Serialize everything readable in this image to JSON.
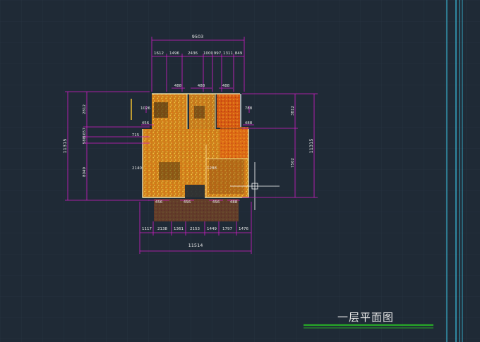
{
  "drawing": {
    "title": "一层平面图",
    "colors": {
      "background": "#1f2a36",
      "grid": "#2a3644",
      "dimension": "#d21ec8",
      "text": "#e8e8e8",
      "cloud_primary": "#f0a020",
      "cloud_secondary": "#e05010",
      "cloud_highlight": "#ffe040",
      "title_line": "#28a828",
      "border_line": "#3cc8e8",
      "crosshair": "#ffffff"
    },
    "dimensions": {
      "top_total": "9503",
      "top_segments": [
        "1612",
        "1496",
        "2436",
        "1000",
        "997",
        "1311",
        "849"
      ],
      "bottom_total": "11514",
      "bottom_segments": [
        "1117",
        "2138",
        "1361",
        "2153",
        "1449",
        "1797",
        "1476"
      ],
      "left_total": "11315",
      "left_segments": [
        "2812",
        "588",
        "1657",
        "8049"
      ],
      "right_total": "11315",
      "right_segments": [
        "3812",
        "7502"
      ],
      "small_labels": [
        "488",
        "488",
        "488",
        "715",
        "1026",
        "456",
        "788",
        "488",
        "2140",
        "456",
        "456",
        "1288",
        "456",
        "488"
      ]
    }
  }
}
